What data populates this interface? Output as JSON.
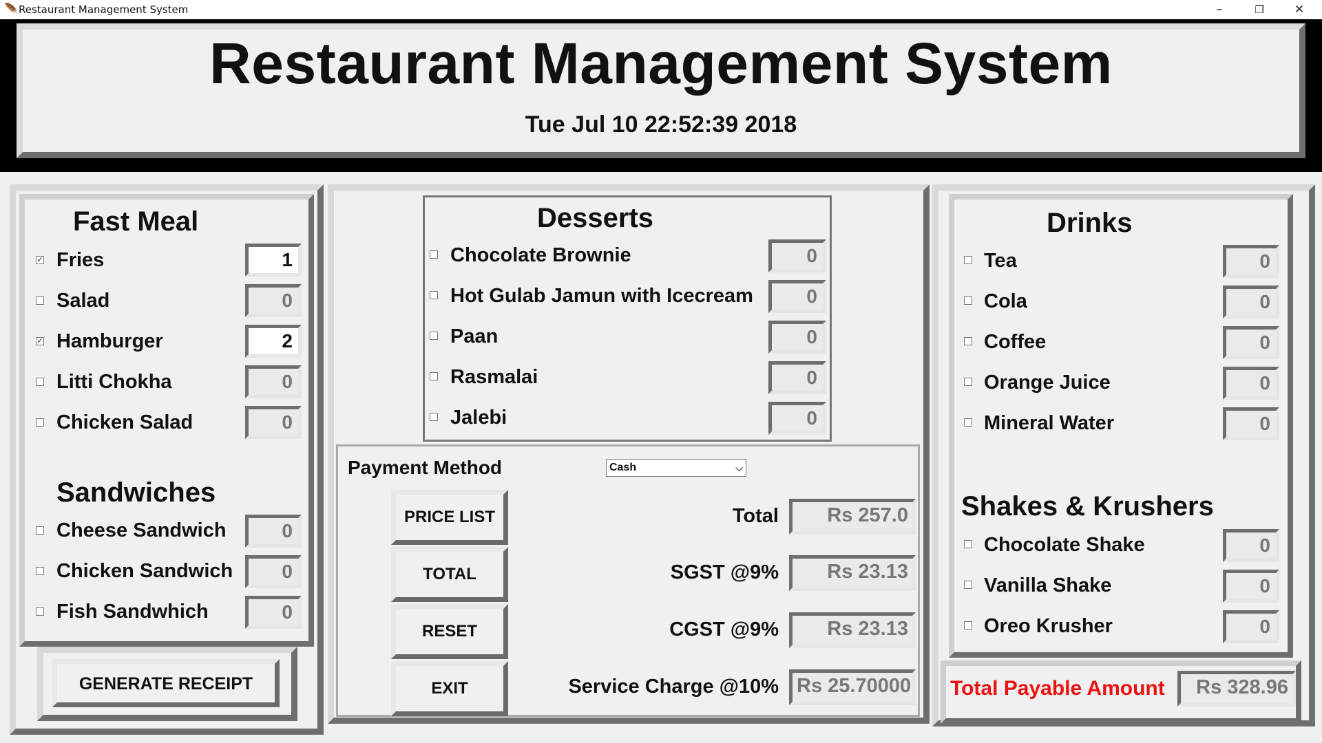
{
  "window": {
    "title": "Restaurant Management System",
    "minimize": "–",
    "restore": "❐",
    "close": "✕"
  },
  "header": {
    "title": "Restaurant Management System",
    "datetime": "Tue Jul 10 22:52:39 2018"
  },
  "fast_meal": {
    "heading": "Fast Meal",
    "items": [
      {
        "label": "Fries",
        "checked": true,
        "qty": "1"
      },
      {
        "label": "Salad",
        "checked": false,
        "qty": "0"
      },
      {
        "label": "Hamburger",
        "checked": true,
        "qty": "2"
      },
      {
        "label": "Litti Chokha",
        "checked": false,
        "qty": "0"
      },
      {
        "label": "Chicken Salad",
        "checked": false,
        "qty": "0"
      }
    ]
  },
  "sandwiches": {
    "heading": "Sandwiches",
    "items": [
      {
        "label": "Cheese Sandwich",
        "checked": false,
        "qty": "0"
      },
      {
        "label": "Chicken Sandwich",
        "checked": false,
        "qty": "0"
      },
      {
        "label": "Fish Sandwhich",
        "checked": false,
        "qty": "0"
      }
    ]
  },
  "desserts": {
    "heading": "Desserts",
    "items": [
      {
        "label": "Chocolate Brownie",
        "checked": false,
        "qty": "0"
      },
      {
        "label": "Hot Gulab Jamun with Icecream",
        "checked": false,
        "qty": "0"
      },
      {
        "label": "Paan",
        "checked": false,
        "qty": "0"
      },
      {
        "label": "Rasmalai",
        "checked": false,
        "qty": "0"
      },
      {
        "label": "Jalebi",
        "checked": false,
        "qty": "0"
      }
    ]
  },
  "drinks": {
    "heading": "Drinks",
    "items": [
      {
        "label": "Tea",
        "checked": false,
        "qty": "0"
      },
      {
        "label": "Cola",
        "checked": false,
        "qty": "0"
      },
      {
        "label": "Coffee",
        "checked": false,
        "qty": "0"
      },
      {
        "label": "Orange Juice",
        "checked": false,
        "qty": "0"
      },
      {
        "label": "Mineral Water",
        "checked": false,
        "qty": "0"
      }
    ]
  },
  "shakes": {
    "heading": "Shakes & Krushers",
    "items": [
      {
        "label": "Chocolate Shake",
        "checked": false,
        "qty": "0"
      },
      {
        "label": "Vanilla Shake",
        "checked": false,
        "qty": "0"
      },
      {
        "label": "Oreo Krusher",
        "checked": false,
        "qty": "0"
      }
    ]
  },
  "payment": {
    "label": "Payment Method",
    "selected": "Cash",
    "buttons": {
      "price_list": "PRICE LIST",
      "total": "TOTAL",
      "reset": "RESET",
      "exit": "EXIT"
    },
    "total_label": "Total",
    "total_value": "Rs 257.0",
    "sgst_label": "SGST @9%",
    "sgst_value": "Rs 23.13",
    "cgst_label": "CGST @9%",
    "cgst_value": "Rs 23.13",
    "service_label": "Service Charge @10%",
    "service_value": "Rs 25.70000"
  },
  "receipt": {
    "generate_label": "GENERATE RECEIPT"
  },
  "payable": {
    "label": "Total Payable Amount",
    "value": "Rs 328.96",
    "label_color": "#ee1111"
  }
}
